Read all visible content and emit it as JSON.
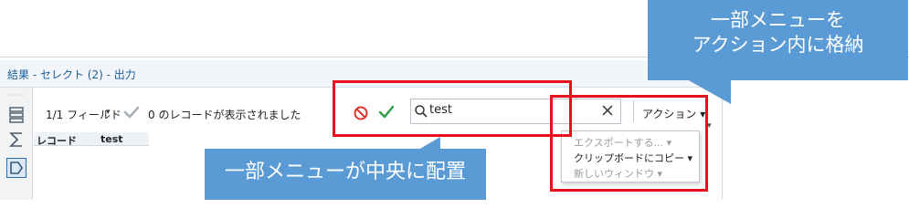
{
  "window": {
    "title": "結果 - セレクト (2) - 出力"
  },
  "toolbar": {
    "fields_label": "1/1 フィールド",
    "fields_caret": "▾",
    "records_status": "0 のレコードが表示されました",
    "search_value": "test",
    "clear_glyph": "✕",
    "action_label": "アクション ▾"
  },
  "table": {
    "columns": [
      "レコード",
      "test"
    ]
  },
  "action_menu": {
    "items": [
      {
        "label": "エクスポートする... ▾",
        "enabled": false
      },
      {
        "label": "クリップボードにコピー ▾",
        "enabled": true
      },
      {
        "label": "新しいウィンドウ ▾",
        "enabled": false
      }
    ]
  },
  "annotations": {
    "top_callout_line1": "一部メニューを",
    "top_callout_line2": "アクション内に格納",
    "bottom_callout": "一部メニューが中央に配置"
  },
  "colors": {
    "highlight_red": "#e8101c",
    "callout_blue": "#5b9bd5",
    "title_blue": "#1c5e9b",
    "apply_green": "#2e9e48",
    "cancel_red": "#d9352b"
  },
  "icons": {
    "rail": [
      "rows-icon",
      "sigma-icon",
      "tag-icon"
    ],
    "toolbar": [
      "checkmark-grey-icon",
      "cancel-icon",
      "apply-check-icon",
      "search-icon",
      "clear-icon"
    ]
  }
}
